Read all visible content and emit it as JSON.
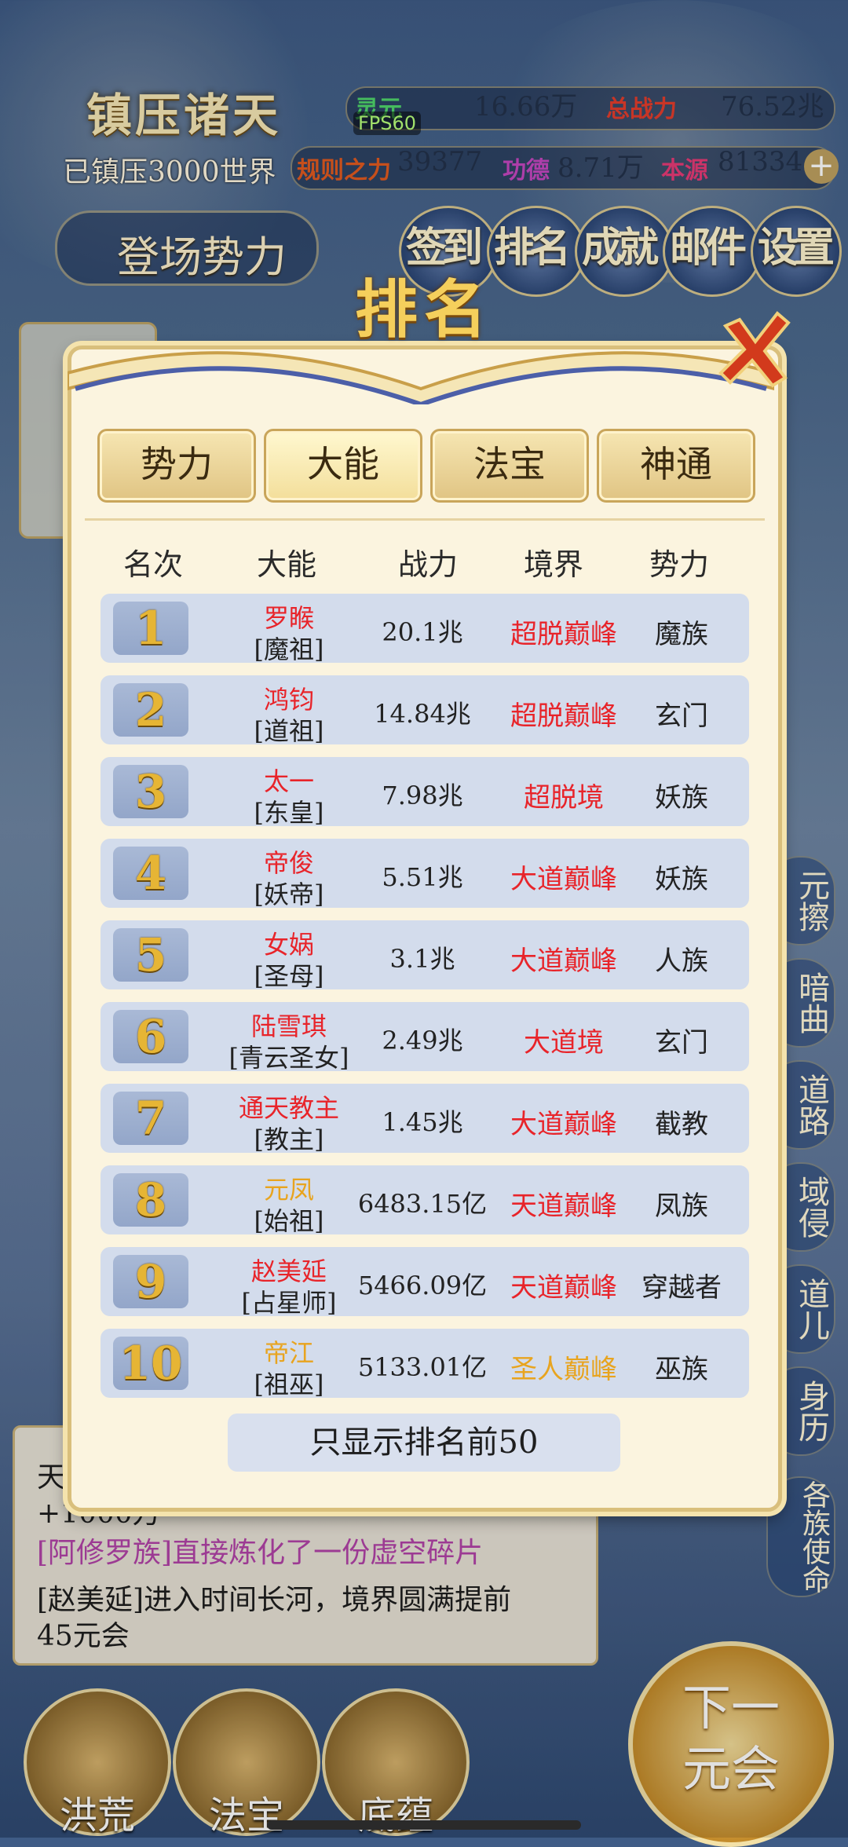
{
  "hud": {
    "title": "镇压诸天",
    "suppressed": "已镇压3000世界",
    "spirit_label": "灵元",
    "spirit_value": "16.66万",
    "total_power_label": "总战力",
    "total_power_value": "76.52兆",
    "rule_label": "规则之力",
    "rule_value": "39377",
    "merit_label": "功德",
    "merit_value": "8.71万",
    "origin_label": "本源",
    "origin_value": "81334",
    "fps": "FPS60",
    "entrance": "登场势力",
    "menu": [
      "签到",
      "排名",
      "成就",
      "邮件",
      "设置"
    ],
    "side_buttons": [
      "元擦",
      "暗曲",
      "道路",
      "域侵",
      "道儿",
      "身历",
      "各族使命"
    ]
  },
  "modal": {
    "title": "排名",
    "tabs": [
      "势力",
      "大能",
      "法宝",
      "神通"
    ],
    "active_tab": "大能",
    "headers": [
      "名次",
      "大能",
      "战力",
      "境界",
      "势力"
    ],
    "rows": [
      {
        "rank": "1",
        "name": "罗睺",
        "title": "[魔祖]",
        "power": "20.1兆",
        "realm": "超脱巅峰",
        "faction": "魔族",
        "name_color": "#e8242a",
        "realm_color": "#e8242a"
      },
      {
        "rank": "2",
        "name": "鸿钧",
        "title": "[道祖]",
        "power": "14.84兆",
        "realm": "超脱巅峰",
        "faction": "玄门",
        "name_color": "#e8242a",
        "realm_color": "#e8242a"
      },
      {
        "rank": "3",
        "name": "太一",
        "title": "[东皇]",
        "power": "7.98兆",
        "realm": "超脱境",
        "faction": "妖族",
        "name_color": "#e8242a",
        "realm_color": "#e8242a"
      },
      {
        "rank": "4",
        "name": "帝俊",
        "title": "[妖帝]",
        "power": "5.51兆",
        "realm": "大道巅峰",
        "faction": "妖族",
        "name_color": "#e8242a",
        "realm_color": "#e8242a"
      },
      {
        "rank": "5",
        "name": "女娲",
        "title": "[圣母]",
        "power": "3.1兆",
        "realm": "大道巅峰",
        "faction": "人族",
        "name_color": "#e8242a",
        "realm_color": "#e8242a"
      },
      {
        "rank": "6",
        "name": "陆雪琪",
        "title": "[青云圣女]",
        "power": "2.49兆",
        "realm": "大道境",
        "faction": "玄门",
        "name_color": "#e8242a",
        "realm_color": "#e8242a"
      },
      {
        "rank": "7",
        "name": "通天教主",
        "title": "[教主]",
        "power": "1.45兆",
        "realm": "大道巅峰",
        "faction": "截教",
        "name_color": "#e8242a",
        "realm_color": "#e8242a"
      },
      {
        "rank": "8",
        "name": "元凤",
        "title": "[始祖]",
        "power": "6483.15亿",
        "realm": "天道巅峰",
        "faction": "凤族",
        "name_color": "#e8a41f",
        "realm_color": "#e8242a"
      },
      {
        "rank": "9",
        "name": "赵美延",
        "title": "[占星师]",
        "power": "5466.09亿",
        "realm": "天道巅峰",
        "faction": "穿越者",
        "name_color": "#e8242a",
        "realm_color": "#e8242a"
      },
      {
        "rank": "10",
        "name": "帝江",
        "title": "[祖巫]",
        "power": "5133.01亿",
        "realm": "圣人巅峰",
        "faction": "巫族",
        "name_color": "#e8a41f",
        "realm_color": "#e8a41f"
      }
    ],
    "footer": "只显示排名前50"
  },
  "log": {
    "line1": "天",
    "line2": "+1000万",
    "line3": "[阿修罗族]直接炼化了一份虚空碎片",
    "line4": "[赵美延]进入时间长河，境界圆满提前",
    "line5": "45元会"
  },
  "bottom": {
    "buttons": [
      "洪荒",
      "法宝",
      "底蕴"
    ],
    "next": "下一元会"
  }
}
